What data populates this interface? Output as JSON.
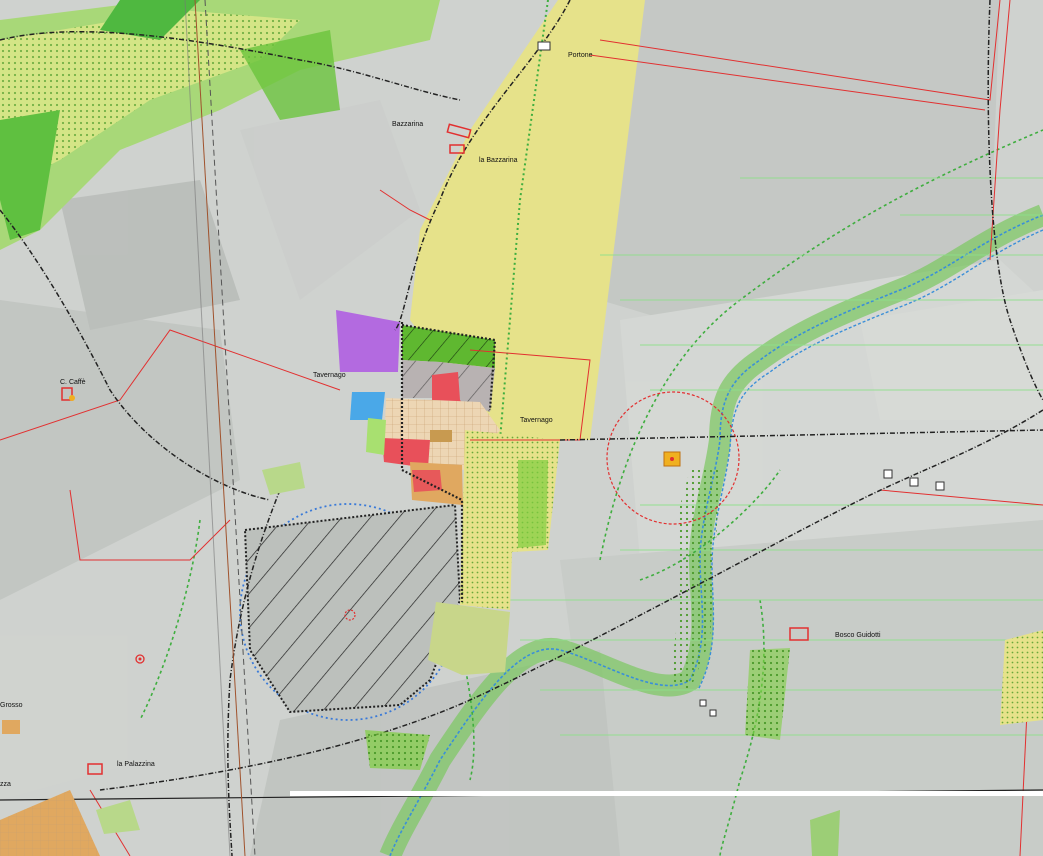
{
  "map": {
    "colors": {
      "background": "#cfd2cf",
      "field_light": "#dcdedb",
      "field_dark": "#b4b8b4",
      "farmland_green": "#7fcf3f",
      "yellow_zone": "#e6e28a",
      "purple_zone": "#b36ae0",
      "blue_zone": "#4aa8e8",
      "red_zone": "#e8505a",
      "orange_zone": "#e0a860",
      "river_blue": "#3a8fd8",
      "boundary_red": "#e23030",
      "road_black": "#222222",
      "hedge_green": "#3fae3f"
    },
    "places": [
      {
        "id": "portone",
        "label": "Portone"
      },
      {
        "id": "bazzarina",
        "label": "Bazzarina"
      },
      {
        "id": "la-bazzarina",
        "label": "la Bazzarina"
      },
      {
        "id": "c-caffe",
        "label": "C. Caffè"
      },
      {
        "id": "tavernago-west",
        "label": "Tavernago"
      },
      {
        "id": "tavernago-east",
        "label": "Tavernago"
      },
      {
        "id": "bosco-guidotti",
        "label": "Bosco Guidotti"
      },
      {
        "id": "grosso",
        "label": "Grosso"
      },
      {
        "id": "la-palazzina",
        "label": "la Palazzina"
      },
      {
        "id": "zza",
        "label": "zza"
      }
    ]
  }
}
